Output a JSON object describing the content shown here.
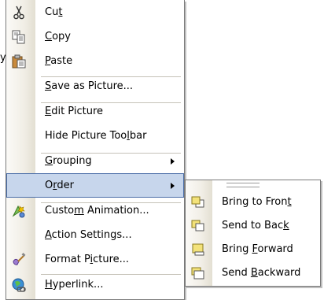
{
  "background_fragment": "y.",
  "menu": {
    "items": [
      {
        "icon": "scissors-icon",
        "pre": "Cu",
        "key": "t",
        "post": ""
      },
      {
        "icon": "copy-icon",
        "pre": "",
        "key": "C",
        "post": "opy"
      },
      {
        "icon": "paste-icon",
        "pre": "",
        "key": "P",
        "post": "aste"
      },
      {
        "icon": "",
        "pre": "",
        "key": "S",
        "post": "ave as Picture..."
      },
      {
        "icon": "",
        "pre": "",
        "key": "E",
        "post": "dit Picture"
      },
      {
        "icon": "",
        "pre": "Hide Picture Too",
        "key": "l",
        "post": "bar"
      },
      {
        "icon": "",
        "pre": "",
        "key": "G",
        "post": "rouping"
      },
      {
        "icon": "",
        "pre": "O",
        "key": "r",
        "post": "der"
      },
      {
        "icon": "custom-animation-icon",
        "pre": "Custo",
        "key": "m",
        "post": " Animation..."
      },
      {
        "icon": "",
        "pre": "",
        "key": "A",
        "post": "ction Settings..."
      },
      {
        "icon": "format-picture-icon",
        "pre": "Format P",
        "key": "i",
        "post": "cture..."
      },
      {
        "icon": "hyperlink-icon",
        "pre": "",
        "key": "H",
        "post": "yperlink..."
      }
    ]
  },
  "submenu": {
    "items": [
      {
        "icon": "bring-to-front-icon",
        "pre": "Bring to Fron",
        "key": "t",
        "post": ""
      },
      {
        "icon": "send-to-back-icon",
        "pre": "Send to Bac",
        "key": "k",
        "post": ""
      },
      {
        "icon": "bring-forward-icon",
        "pre": "Bring ",
        "key": "F",
        "post": "orward"
      },
      {
        "icon": "send-backward-icon",
        "pre": "Send ",
        "key": "B",
        "post": "ackward"
      }
    ]
  },
  "colors": {
    "highlight": "#c7d6ec",
    "highlight_border": "#4b6ea8",
    "gutter": "#f1eee6"
  }
}
